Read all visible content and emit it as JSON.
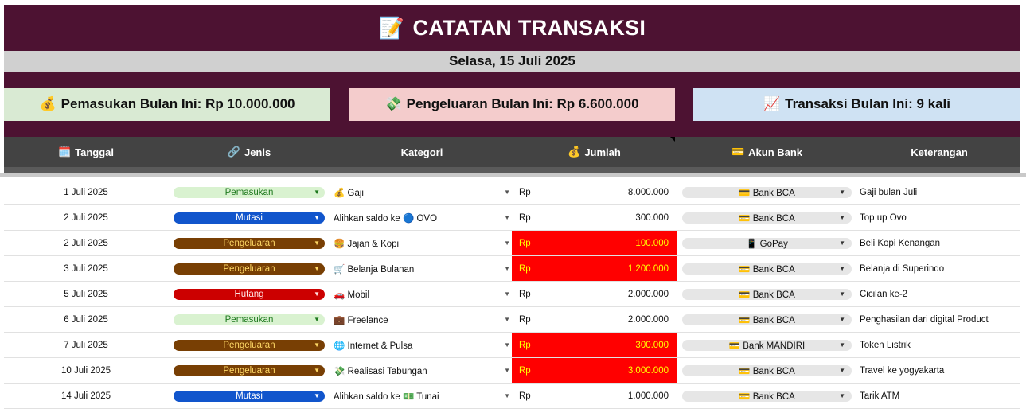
{
  "title": {
    "emoji": "📝",
    "text": "CATATAN TRANSAKSI"
  },
  "date_line": "Selasa, 15 Juli 2025",
  "summary": {
    "income": {
      "emoji": "💰",
      "text": "Pemasukan Bulan Ini: Rp 10.000.000"
    },
    "expense": {
      "emoji": "💸",
      "text": "Pengeluaran Bulan Ini: Rp 6.600.000"
    },
    "count": {
      "emoji": "📈",
      "text": "Transaksi Bulan Ini: 9 kali"
    }
  },
  "headers": [
    {
      "emoji": "🗓️",
      "label": "Tanggal"
    },
    {
      "emoji": "🔗",
      "label": "Jenis"
    },
    {
      "emoji": "",
      "label": "Kategori"
    },
    {
      "emoji": "💰",
      "label": "Jumlah"
    },
    {
      "emoji": "💳",
      "label": "Akun Bank"
    },
    {
      "emoji": "",
      "label": "Keterangan"
    }
  ],
  "colors": {
    "Pemasukan": {
      "bg": "#d9f2d0",
      "fg": "#1f7a1f"
    },
    "Mutasi": {
      "bg": "#1155cc",
      "fg": "#ffffff"
    },
    "Pengeluaran": {
      "bg": "#783f04",
      "fg": "#ffd966"
    },
    "Hutang": {
      "bg": "#cc0000",
      "fg": "#ffe5e5"
    }
  },
  "rows": [
    {
      "date": "1 Juli 2025",
      "type": "Pemasukan",
      "category": "💰 Gaji",
      "currency": "Rp",
      "amount": "8.000.000",
      "highlight": false,
      "bank": "💳 Bank BCA",
      "note": "Gaji bulan Juli"
    },
    {
      "date": "2 Juli 2025",
      "type": "Mutasi",
      "category": "Alihkan saldo ke 🔵 OVO",
      "currency": "Rp",
      "amount": "300.000",
      "highlight": false,
      "bank": "💳 Bank BCA",
      "note": "Top up Ovo"
    },
    {
      "date": "2 Juli 2025",
      "type": "Pengeluaran",
      "category": "🍔 Jajan & Kopi",
      "currency": "Rp",
      "amount": "100.000",
      "highlight": true,
      "bank": "📱 GoPay",
      "note": "Beli Kopi Kenangan"
    },
    {
      "date": "3 Juli 2025",
      "type": "Pengeluaran",
      "category": "🛒 Belanja Bulanan",
      "currency": "Rp",
      "amount": "1.200.000",
      "highlight": true,
      "bank": "💳 Bank BCA",
      "note": "Belanja di Superindo"
    },
    {
      "date": "5 Juli 2025",
      "type": "Hutang",
      "category": "🚗 Mobil",
      "currency": "Rp",
      "amount": "2.000.000",
      "highlight": false,
      "bank": "💳 Bank BCA",
      "note": "Cicilan ke-2"
    },
    {
      "date": "6 Juli 2025",
      "type": "Pemasukan",
      "category": "💼 Freelance",
      "currency": "Rp",
      "amount": "2.000.000",
      "highlight": false,
      "bank": "💳 Bank BCA",
      "note": "Penghasilan dari digital Product"
    },
    {
      "date": "7 Juli 2025",
      "type": "Pengeluaran",
      "category": "🌐 Internet & Pulsa",
      "currency": "Rp",
      "amount": "300.000",
      "highlight": true,
      "bank": "💳 Bank MANDIRI",
      "note": "Token Listrik"
    },
    {
      "date": "10 Juli 2025",
      "type": "Pengeluaran",
      "category": "💸 Realisasi Tabungan",
      "currency": "Rp",
      "amount": "3.000.000",
      "highlight": true,
      "bank": "💳 Bank BCA",
      "note": "Travel ke yogyakarta"
    },
    {
      "date": "14 Juli 2025",
      "type": "Mutasi",
      "category": "Alihkan saldo ke 💵 Tunai",
      "currency": "Rp",
      "amount": "1.000.000",
      "highlight": false,
      "bank": "💳 Bank BCA",
      "note": "Tarik ATM"
    }
  ]
}
